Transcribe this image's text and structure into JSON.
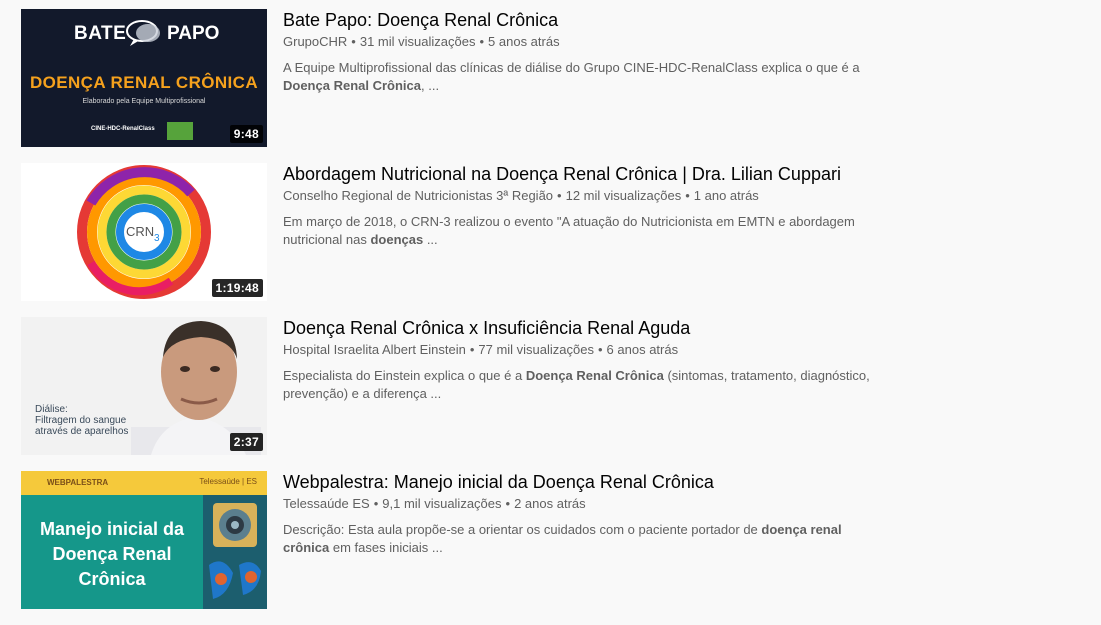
{
  "videos": [
    {
      "title": "Bate Papo: Doença Renal Crônica",
      "channel": "GrupoCHR",
      "views": "31 mil visualizações",
      "age": "5 anos atrás",
      "desc_before": "A Equipe Multiprofissional das clínicas de diálise do Grupo CINE-HDC-RenalClass explica o que é a ",
      "desc_bold": "Doença Renal Crônica",
      "desc_after": ", ...",
      "duration": "9:48",
      "thumb": {
        "brand_left": "BATE",
        "brand_right": "PAPO",
        "headline": "DOENÇA RENAL CRÔNICA",
        "sub": "Elaborado pela Equipe Multiprofissional",
        "logos": "CINE-HDC-RenalClass"
      }
    },
    {
      "title": "Abordagem Nutricional na Doença Renal Crônica | Dra. Lilian Cuppari",
      "channel": "Conselho Regional de Nutricionistas 3ª Região",
      "views": "12 mil visualizações",
      "age": "1 ano atrás",
      "desc_before": "Em março de 2018, o CRN-3 realizou o evento \"A atuação do Nutricionista em EMTN e abordagem nutricional nas ",
      "desc_bold": "doenças",
      "desc_after": " ...",
      "duration": "1:19:48",
      "thumb": {
        "logo": "CRN",
        "logo_num": "3"
      }
    },
    {
      "title": "Doença Renal Crônica x Insuficiência Renal Aguda",
      "channel": "Hospital Israelita Albert Einstein",
      "views": "77 mil visualizações",
      "age": "6 anos atrás",
      "desc_before": "Especialista do Einstein explica o que é a ",
      "desc_bold": "Doença Renal Crônica",
      "desc_after": " (sintomas, tratamento, diagnóstico, prevenção) e a diferença ...",
      "duration": "2:37",
      "thumb": {
        "caption1": "Diálise:",
        "caption2": "Filtragem do sangue",
        "caption3": "através de aparelhos"
      }
    },
    {
      "title": "Webpalestra: Manejo inicial da Doença Renal Crônica",
      "channel": "Telessaúde ES",
      "views": "9,1 mil visualizações",
      "age": "2 anos atrás",
      "desc_before": "Descrição: Esta aula propõe-se a orientar os cuidados com o paciente portador de ",
      "desc_bold": "doença renal crônica",
      "desc_after": " em fases iniciais ...",
      "duration": "",
      "thumb": {
        "top_left": "WEBPALESTRA",
        "top_right": "Telessaúde | ES",
        "line1": "Manejo inicial da",
        "line2": "Doença Renal",
        "line3": "Crônica"
      }
    }
  ],
  "colors": {
    "background": "#f9f9f9",
    "meta": "#606060",
    "title": "#030303"
  }
}
